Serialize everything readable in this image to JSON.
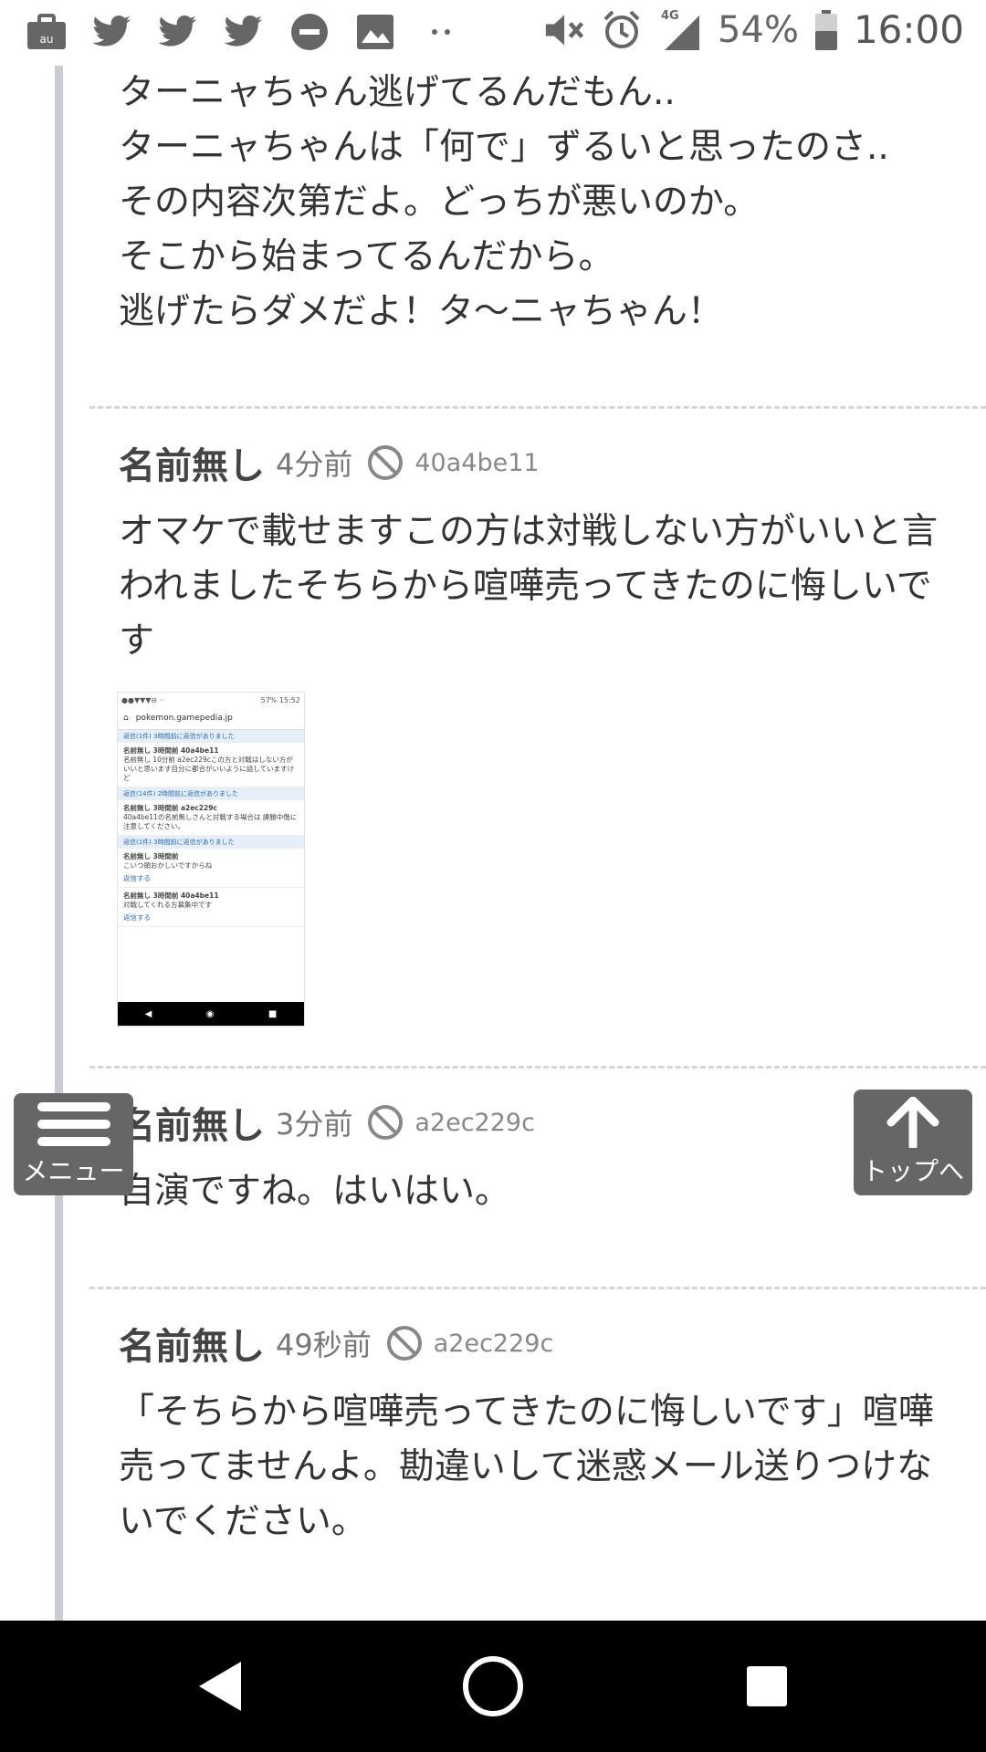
{
  "status_bar": {
    "left_icons": [
      "au-briefcase-icon",
      "twitter-icon",
      "twitter-icon",
      "twitter-icon",
      "do-not-disturb-icon",
      "image-icon",
      "more-dots-icon"
    ],
    "network": "4G",
    "battery": "54%",
    "time": "16:00"
  },
  "top_text": {
    "lines": [
      "ターニャちゃん逃げてるんだもん..",
      "ターニャちゃんは「何で」ずるいと思ったのさ..",
      "その内容次第だよ。どっちが悪いのか。",
      "そこから始まってるんだから。",
      "逃げたらダメだよ！タ〜ニャちゃん！"
    ]
  },
  "comments": [
    {
      "name": "名前無し",
      "time": "4分前",
      "hash": "40a4be11",
      "body": "オマケで載せますこの方は対戦しない方がいいと言われましたそちらから喧嘩売ってきたのに悔しいです"
    },
    {
      "name": "名前無し",
      "time": "3分前",
      "hash": "a2ec229c",
      "body": "自演ですね。はいはい。"
    },
    {
      "name": "名前無し",
      "time": "49秒前",
      "hash": "a2ec229c",
      "body": "「そちらから喧嘩売ってきたのに悔しいです」喧嘩売ってませんよ。勘違いして迷惑メール送りつけないでください。"
    }
  ],
  "thumbnail": {
    "status": "57% 15:52",
    "url": "pokemon.gamepedia.jp",
    "bar1": "返信(1件) 3時間前に返信がありました",
    "block1_meta": "名前無し 3時間前 40a4be11",
    "block1_text": "名前無し 10分前 a2ec229cこの方と対戦はしない方がいいと思います自分に都合がいいように話していますけど",
    "bar2": "返信(14件) 2時間前に返信がありました",
    "block2_meta": "名前無し 3時間前 a2ec229c",
    "block2_text": "40a4be11の名前無しさんと対戦する場合は 諫勝中傷に注意してください。",
    "bar3": "返信(1件) 3時間前に返信がありました",
    "block3_meta": "名前無し 3時間前",
    "block3_text": "こいつ頭おかしいですからね",
    "reply_label": "返信する",
    "block4_meta": "名前無し 3時間前 40a4be11",
    "block4_text": "対戦してくれる方募集中です",
    "reply_label2": "返信する"
  },
  "menu_button": {
    "label": "メニュー"
  },
  "top_button": {
    "label": "トップへ"
  },
  "colors": {
    "float_button_bg": "#666666",
    "thread_line": "#c9cdd3",
    "divider": "#d6d6d6"
  }
}
